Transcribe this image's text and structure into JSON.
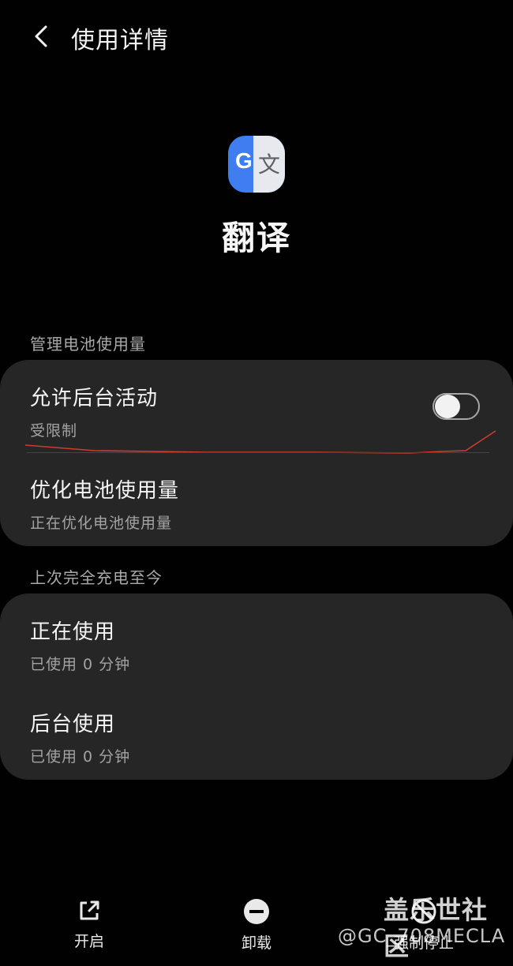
{
  "header": {
    "title": "使用详情"
  },
  "app": {
    "icon_letter": "G",
    "icon_char": "文",
    "name": "翻译"
  },
  "battery_section": {
    "title": "管理电池使用量",
    "background_activity": {
      "title": "允许后台活动",
      "subtitle": "受限制",
      "toggle_on": false
    },
    "optimize": {
      "title": "优化电池使用量",
      "subtitle": "正在优化电池使用量"
    }
  },
  "usage_section": {
    "title": "上次完全充电至今",
    "foreground": {
      "title": "正在使用",
      "subtitle": "已使用 0 分钟"
    },
    "background": {
      "title": "后台使用",
      "subtitle": "已使用 0 分钟"
    }
  },
  "bottom_actions": {
    "open": "开启",
    "uninstall": "卸载",
    "force_stop": "强制停止"
  },
  "watermark": {
    "brand": "盖乐世社区",
    "user": "@GC_708MECLA"
  },
  "colors": {
    "background": "#010101",
    "card": "#262626",
    "redline": "#d23a2e",
    "icon_blue": "#3f7df0"
  }
}
